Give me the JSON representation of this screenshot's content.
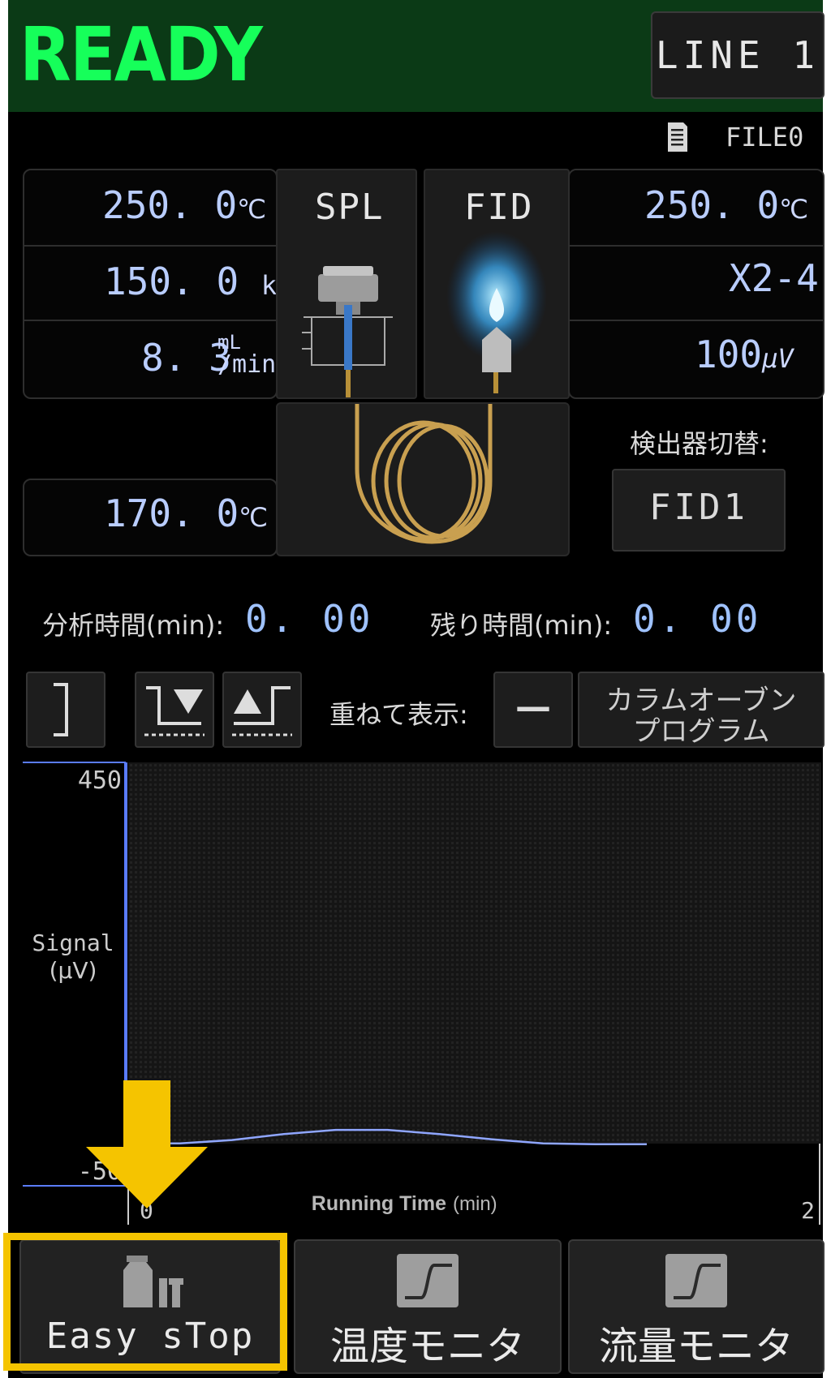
{
  "header": {
    "status": "READY",
    "line_button": "LINE 1"
  },
  "file": {
    "name": "FILE0",
    "icon": "document-icon"
  },
  "spl": {
    "label": "SPL",
    "temp": "250. 0",
    "temp_unit": "℃",
    "pressure": "150. 0",
    "pressure_unit": "kPa",
    "flow": "8. 3",
    "flow_unit_top": "mL",
    "flow_unit_bottom": "/min"
  },
  "fid": {
    "label": "FID",
    "temp": "250. 0",
    "temp_unit": "℃",
    "range": "X2-4",
    "signal": "100",
    "signal_unit": "μV"
  },
  "column": {
    "temp": "170. 0",
    "temp_unit": "℃"
  },
  "detector_switch": {
    "label": "検出器切替:",
    "value": "FID1"
  },
  "times": {
    "analysis_label": "分析時間(min):",
    "analysis_value": "0. 00",
    "remaining_label": "残り時間(min):",
    "remaining_value": "0. 00"
  },
  "toolbar": {
    "overlay_label": "重ねて表示:",
    "overlay_value": "—",
    "program_line1": "カラムオーブン",
    "program_line2": "プログラム"
  },
  "chart_data": {
    "type": "line",
    "ylabel": "Signal\n(μV)",
    "ylabel_line1": "Signal",
    "ylabel_line2": "(μV)",
    "xlabel": "Running Time",
    "xlabel_unit": "(min)",
    "ylim": [
      -50,
      450
    ],
    "xlim": [
      0,
      2
    ],
    "ytick_top": "450",
    "ytick_bottom": "-50",
    "xtick_left": "0",
    "xtick_right": "2",
    "series": [
      {
        "x": [
          0.0,
          0.15,
          0.3,
          0.45,
          0.6,
          0.75,
          0.9,
          1.05,
          1.2,
          1.35,
          1.5
        ],
        "y": [
          0,
          0,
          4,
          11,
          16,
          16,
          11,
          5,
          0,
          -1,
          -1
        ]
      }
    ],
    "colors": {
      "line": "#8fa6ff",
      "axis": "#5a7cff",
      "plot_bg": "#202020"
    }
  },
  "bottom": {
    "easy_stop": "Easy sTop",
    "temp_monitor": "温度モニタ",
    "flow_monitor": "流量モニタ"
  },
  "annotation": {
    "arrow_color": "#f5c400",
    "highlight_color": "#f5c400"
  }
}
